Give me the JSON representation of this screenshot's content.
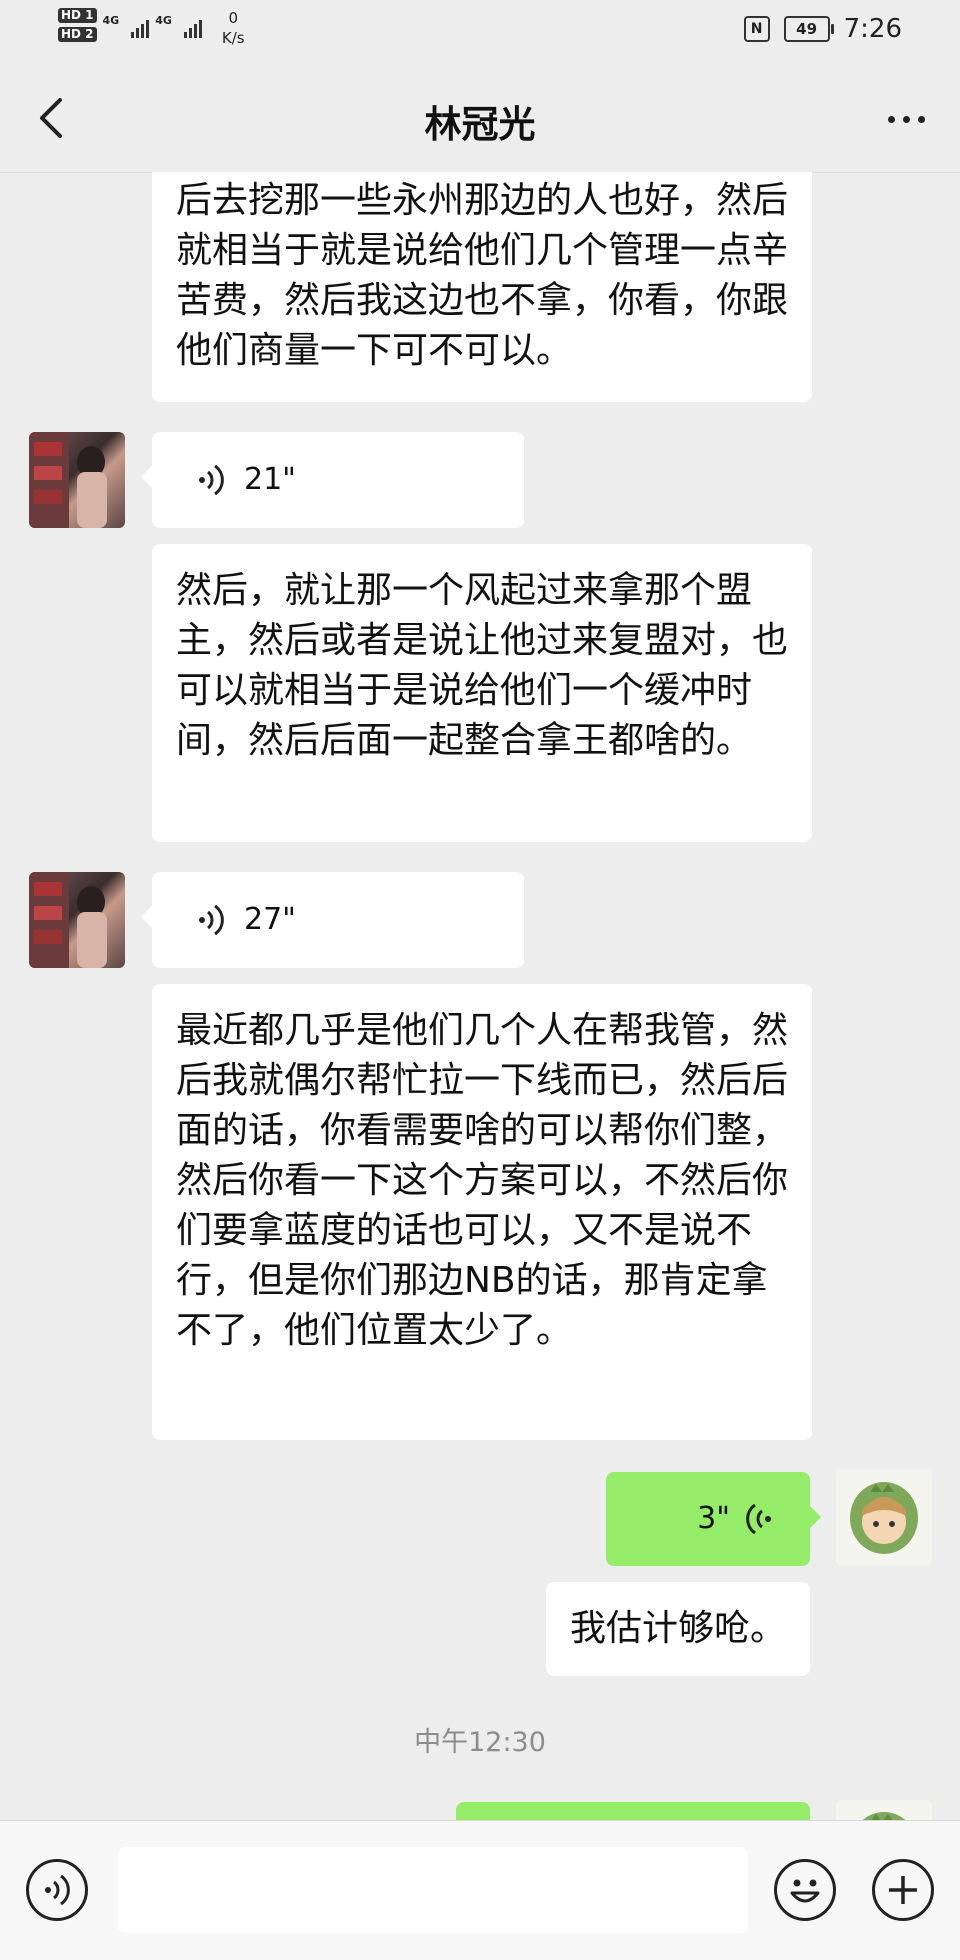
{
  "status": {
    "sim1": "HD 1",
    "sim2": "HD 2",
    "net1": "4G",
    "net2": "4G",
    "speed_value": "0",
    "speed_unit": "K/s",
    "nfc": "N",
    "battery": "49",
    "time": "7:26"
  },
  "header": {
    "title": "林冠光"
  },
  "messages": {
    "m1": "后去挖那一些永州那边的人也好，然后就相当于就是说给他们几个管理一点辛苦费，然后我这边也不拿，你看，你跟他们商量一下可不可以。",
    "v1": "21\"",
    "m2": "然后，就让那一个风起过来拿那个盟主，然后或者是说让他过来复盟对，也可以就相当于是说给他们一个缓冲时间，然后后面一起整合拿王都啥的。",
    "v2": "27\"",
    "m3": "最近都几乎是他们几个人在帮我管，然后我就偶尔帮忙拉一下线而已，然后后面的话，你看需要啥的可以帮你们整，然后你看一下这个方案可以，不然后你们要拿蓝度的话也可以，又不是说不行，但是你们那边NB的话，那肯定拿不了，他们位置太少了。",
    "v3": "3\"",
    "m4": "我估计够呛。",
    "time": "中午12:30"
  },
  "icons": {
    "back": "chevron-left-icon",
    "more": "more-dots-icon",
    "voice": "voice-wave-icon",
    "emoji": "emoji-icon",
    "plus": "plus-icon"
  },
  "colors": {
    "bg": "#ededed",
    "green_bubble": "#95ec69",
    "white_bubble": "#ffffff"
  }
}
